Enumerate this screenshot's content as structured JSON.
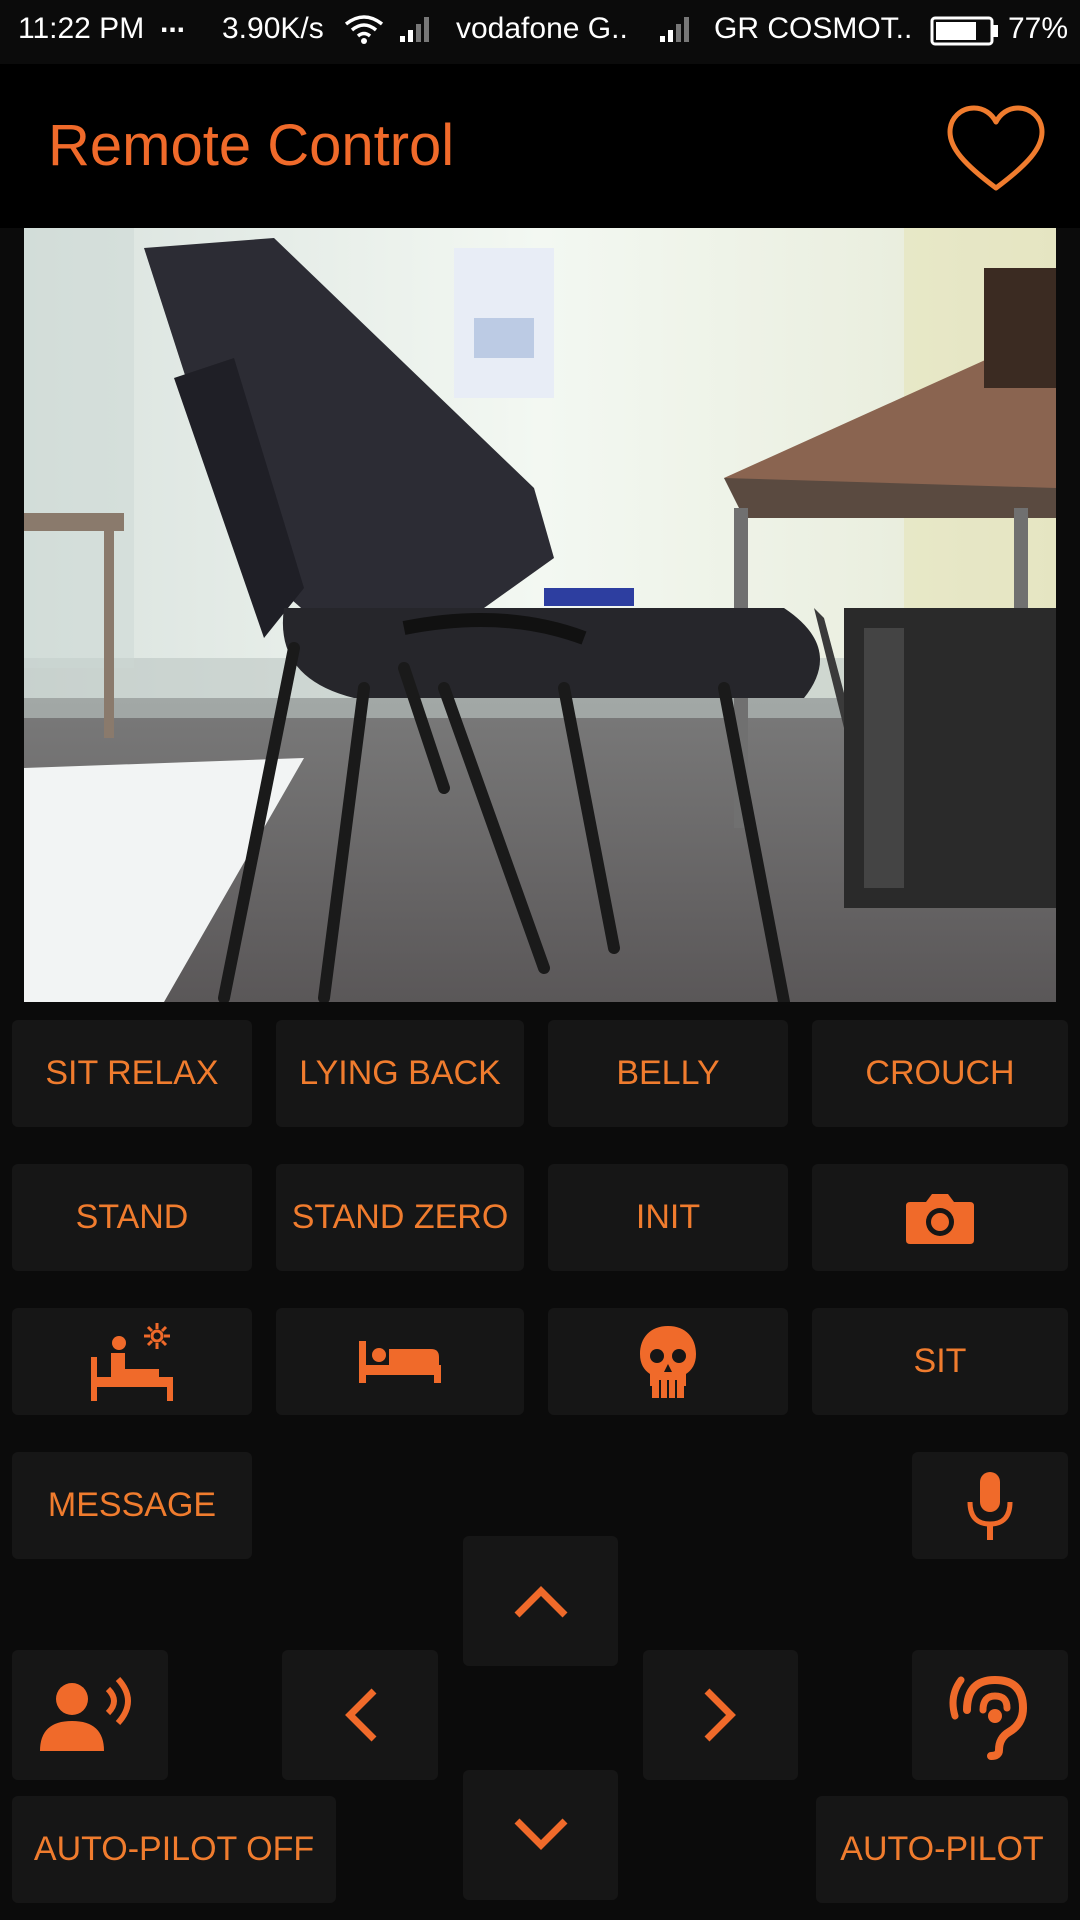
{
  "status_bar": {
    "time": "11:22 PM",
    "dots": "...",
    "speed": "3.90K/s",
    "carrier1": "vodafone G..",
    "carrier2": "GR COSMOT..",
    "battery": "77%",
    "battery_level": 0.77
  },
  "app_bar": {
    "title": "Remote Control",
    "favorite_icon": "heart-icon"
  },
  "camera": {
    "description_icon": "camera-feed"
  },
  "buttons": {
    "sit_relax": "SIT RELAX",
    "lying_back": "LYING BACK",
    "belly": "BELLY",
    "crouch": "CROUCH",
    "stand": "STAND",
    "stand_zero": "STAND ZERO",
    "init": "INIT",
    "camera_icon": "camera-icon",
    "wake_icon": "bed-sun-icon",
    "rest_icon": "bed-icon",
    "kill_icon": "skull-icon",
    "sit": "SIT",
    "message": "MESSAGE",
    "mic_icon": "microphone-icon",
    "speak_icon": "speaking-person-icon",
    "listen_icon": "ear-icon",
    "up_icon": "chevron-up-icon",
    "down_icon": "chevron-down-icon",
    "left_icon": "chevron-left-icon",
    "right_icon": "chevron-right-icon",
    "autopilot_off": "AUTO-PILOT OFF",
    "autopilot": "AUTO-PILOT"
  },
  "colors": {
    "accent": "#f06a2a",
    "label": "#f07c2e",
    "button_bg": "#161616",
    "background": "#0b0b0b"
  }
}
